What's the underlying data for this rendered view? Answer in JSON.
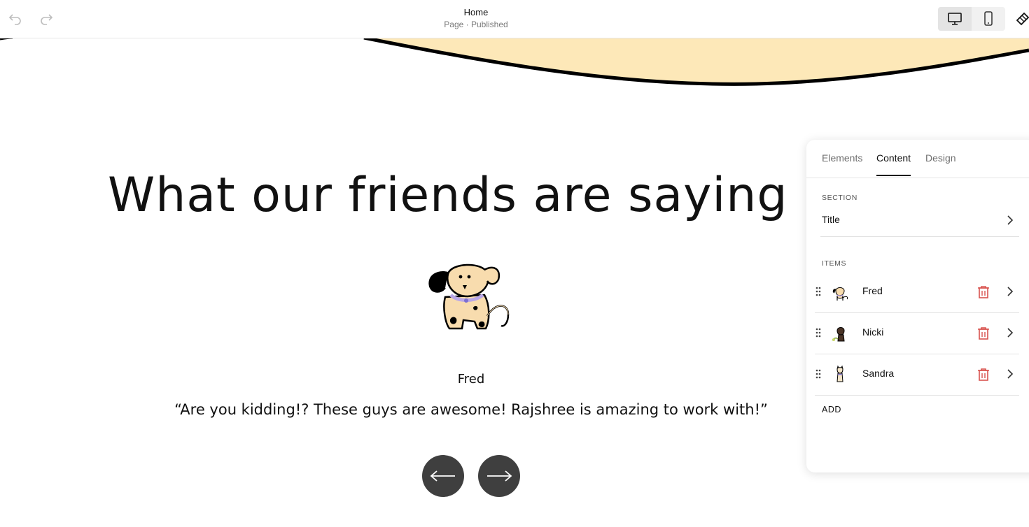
{
  "topbar": {
    "page_title": "Home",
    "page_status": "Page · Published"
  },
  "canvas": {
    "headline": "What our friends are saying",
    "testimonial": {
      "name": "Fred",
      "quote": "“Are you kidding!? These guys are awesome! Rajshree is amazing to work with!”"
    }
  },
  "panel": {
    "tabs": [
      "Elements",
      "Content",
      "Design"
    ],
    "active_tab": "Content",
    "section_label": "SECTION",
    "section_row": "Title",
    "items_label": "ITEMS",
    "items": [
      {
        "name": "Fred"
      },
      {
        "name": "Nicki"
      },
      {
        "name": "Sandra"
      }
    ],
    "add_label": "ADD"
  },
  "colors": {
    "wave_fill": "#fde8b8",
    "nav_button": "#3f3f3f",
    "trash": "#d9534f"
  }
}
